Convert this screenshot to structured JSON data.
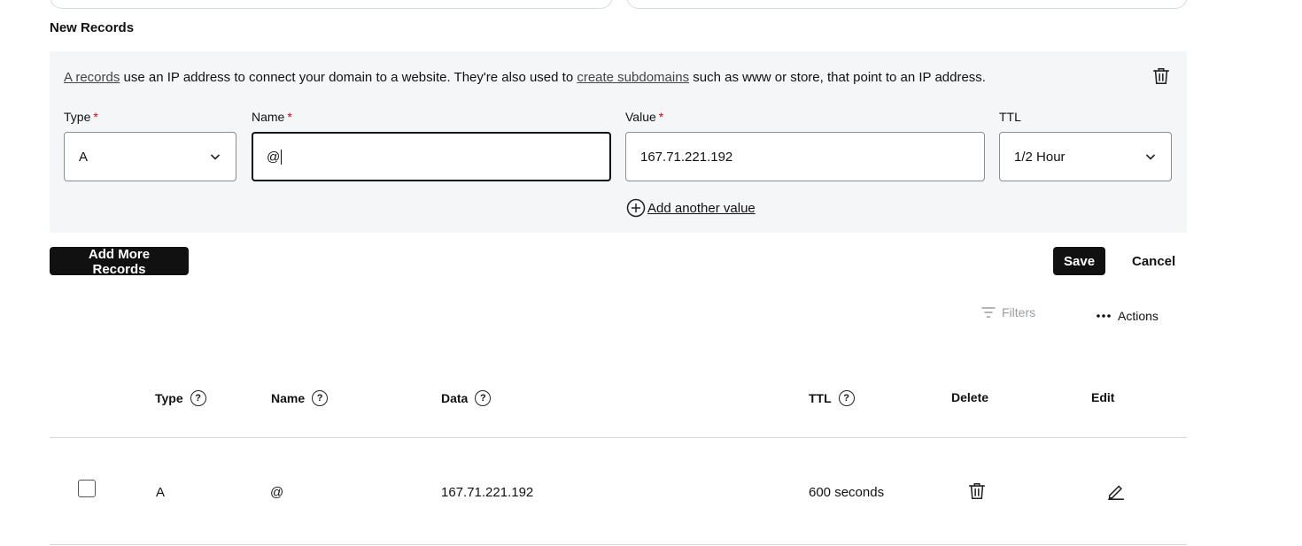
{
  "form": {
    "section_title": "New Records",
    "info": {
      "link1": "A records",
      "text1": " use an IP address to connect your domain to a website. They're also used to ",
      "link2": "create subdomains",
      "text2": " such as www or store, that point to an IP address."
    },
    "type_label": "Type",
    "type_value": "A",
    "name_label": "Name",
    "name_value": "@",
    "value_label": "Value",
    "value_value": "167.71.221.192",
    "ttl_label": "TTL",
    "ttl_value": "1/2 Hour",
    "required_marker": "*",
    "add_value_label": "Add another value"
  },
  "actions": {
    "add_more": "Add More Records",
    "save": "Save",
    "cancel": "Cancel",
    "filters": "Filters",
    "actions": "Actions"
  },
  "table": {
    "headers": {
      "type": "Type",
      "name": "Name",
      "data": "Data",
      "ttl": "TTL",
      "delete": "Delete",
      "edit": "Edit"
    },
    "help_glyph": "?",
    "rows": [
      {
        "type": "A",
        "name": "@",
        "data": "167.71.221.192",
        "ttl": "600 seconds"
      }
    ]
  },
  "icons": {
    "trash": "trash-icon",
    "chevron": "chevron-down-icon",
    "plus_circle": "plus-circle-icon",
    "filter": "filter-icon",
    "more": "more-horizontal-icon",
    "help": "help-circle-icon",
    "pencil": "pencil-icon"
  }
}
